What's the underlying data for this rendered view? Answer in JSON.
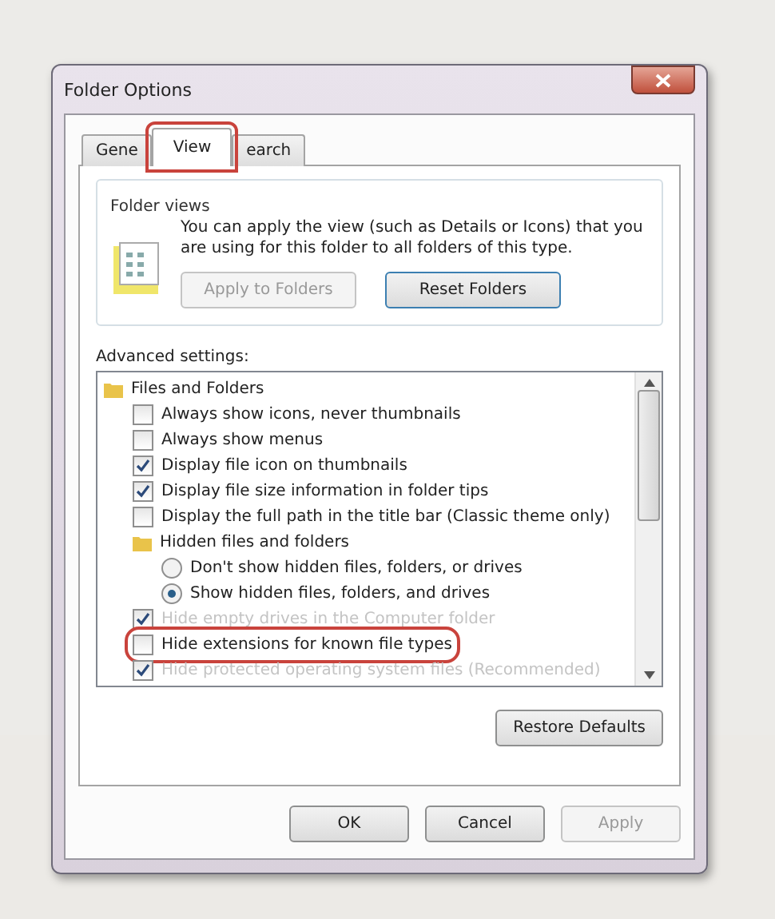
{
  "window": {
    "title": "Folder Options"
  },
  "tabs": [
    {
      "label": "Gene",
      "selected": false,
      "highlighted": false
    },
    {
      "label": "View",
      "selected": true,
      "highlighted": true
    },
    {
      "label": "earch",
      "selected": false,
      "highlighted": false
    }
  ],
  "folder_views": {
    "title": "Folder views",
    "text": "You can apply the view (such as Details or Icons) that you are using for this folder to all folders of this type.",
    "buttons": [
      {
        "label": "Apply to Folders",
        "disabled": true
      },
      {
        "label": "Reset Folders",
        "disabled": false
      }
    ]
  },
  "advanced": {
    "label": "Advanced settings:",
    "items": [
      {
        "kind": "folder",
        "label": "Files and Folders",
        "children": [
          {
            "kind": "checkbox",
            "label": "Always show icons, never thumbnails",
            "checked": false,
            "faded": false,
            "highlighted": false
          },
          {
            "kind": "checkbox",
            "label": "Always show menus",
            "checked": false,
            "faded": false,
            "highlighted": false
          },
          {
            "kind": "checkbox",
            "label": "Display file icon on thumbnails",
            "checked": true,
            "faded": false,
            "highlighted": false
          },
          {
            "kind": "checkbox",
            "label": "Display file size information in folder tips",
            "checked": true,
            "faded": false,
            "highlighted": false
          },
          {
            "kind": "checkbox",
            "label": "Display the full path in the title bar (Classic theme only)",
            "checked": false,
            "faded": false,
            "highlighted": false
          },
          {
            "kind": "folder",
            "label": "Hidden files and folders",
            "children": [
              {
                "kind": "radio",
                "label": "Don't show hidden files, folders, or drives",
                "selected": false
              },
              {
                "kind": "radio",
                "label": "Show hidden files, folders, and drives",
                "selected": true
              }
            ]
          },
          {
            "kind": "checkbox",
            "label": "Hide empty drives in the Computer folder",
            "checked": true,
            "faded": true,
            "highlighted": false
          },
          {
            "kind": "checkbox",
            "label": "Hide extensions for known file types",
            "checked": false,
            "faded": false,
            "highlighted": true
          },
          {
            "kind": "checkbox",
            "label": "Hide protected operating system files (Recommended)",
            "checked": true,
            "faded": true,
            "highlighted": false
          }
        ]
      }
    ],
    "restore_button": "Restore Defaults"
  },
  "buttons": [
    {
      "label": "OK",
      "disabled": false
    },
    {
      "label": "Cancel",
      "disabled": false
    },
    {
      "label": "Apply",
      "disabled": true
    }
  ]
}
